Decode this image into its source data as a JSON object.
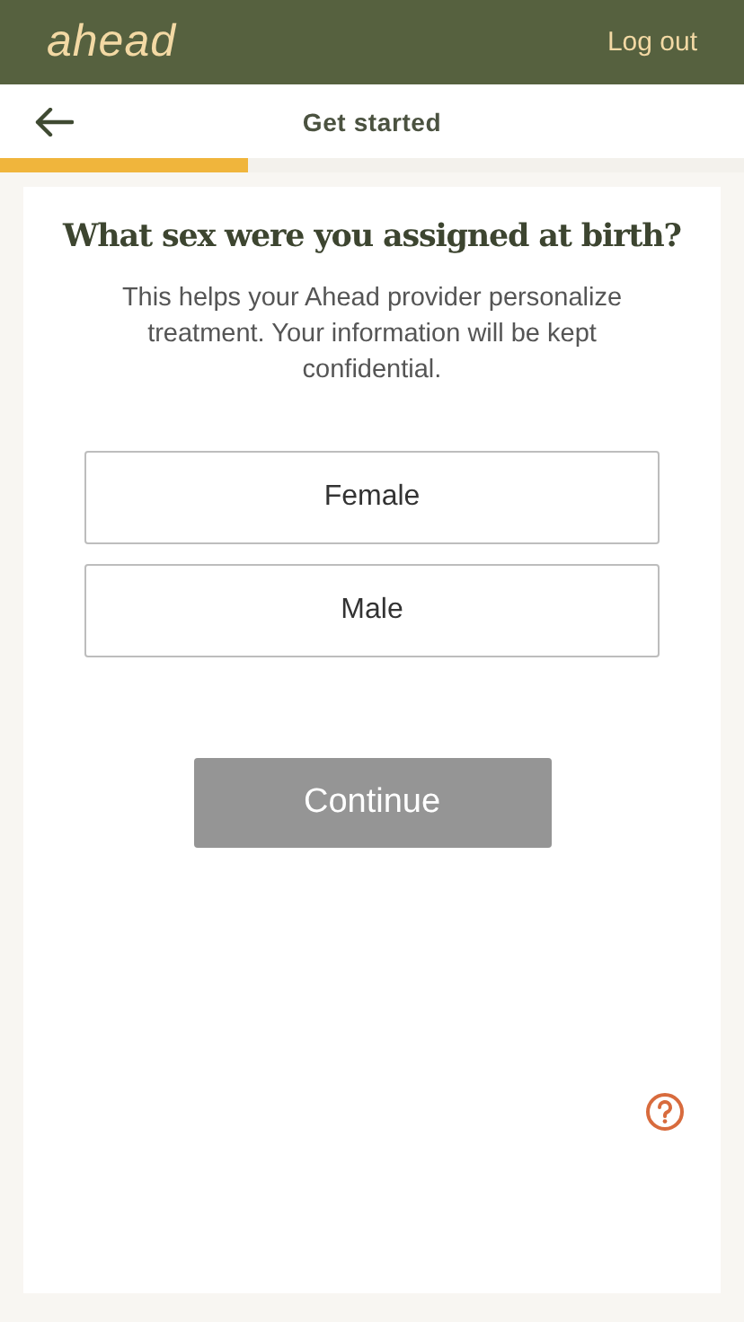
{
  "header": {
    "logo": "ahead",
    "logout": "Log out"
  },
  "nav": {
    "title": "Get started"
  },
  "progress": {
    "level": 0.333
  },
  "question": {
    "title": "What sex were you assigned at birth?",
    "description": "This helps your Ahead provider personalize treatment. Your information will be kept confidential."
  },
  "options": [
    {
      "label": "Female",
      "selected": false
    },
    {
      "label": "Male",
      "selected": false
    }
  ],
  "continue": {
    "label": "Continue",
    "disabled": true
  }
}
